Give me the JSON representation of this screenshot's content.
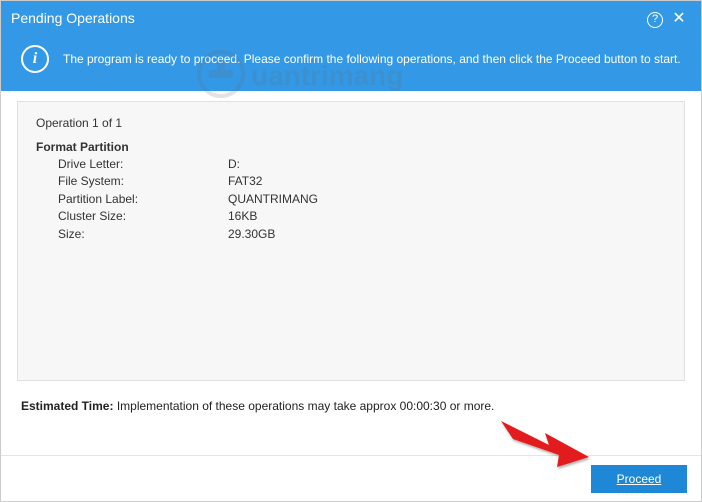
{
  "titlebar": {
    "title": "Pending Operations"
  },
  "info_banner": {
    "text": "The program is ready to proceed. Please confirm the following operations, and then click the Proceed button to start."
  },
  "operation": {
    "count_label": "Operation 1 of 1",
    "title": "Format Partition",
    "rows": [
      {
        "key": "Drive Letter:",
        "value": "D:"
      },
      {
        "key": "File System:",
        "value": "FAT32"
      },
      {
        "key": "Partition Label:",
        "value": "QUANTRIMANG"
      },
      {
        "key": "Cluster Size:",
        "value": "16KB"
      },
      {
        "key": "Size:",
        "value": "29.30GB"
      }
    ]
  },
  "estimate": {
    "label": "Estimated Time:",
    "text": "Implementation of these operations may take approx 00:00:30 or more."
  },
  "buttons": {
    "proceed": "Proceed"
  },
  "watermark": "Quantrimang"
}
